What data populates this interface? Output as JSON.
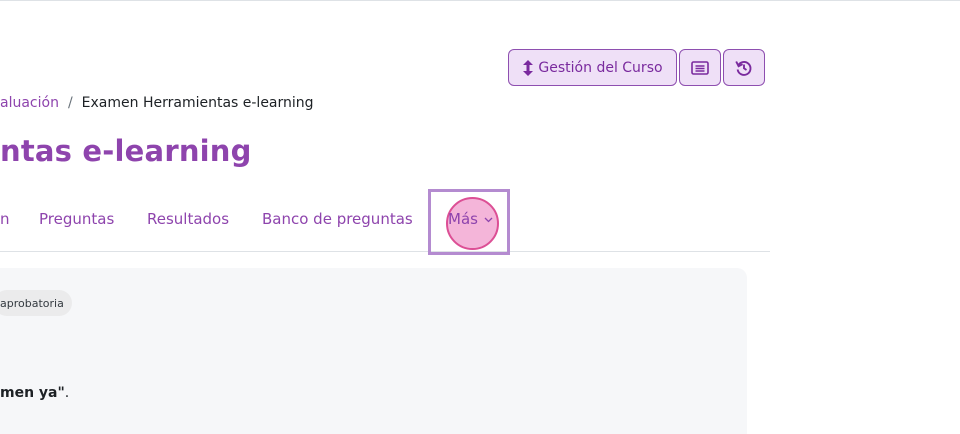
{
  "course_actions": {
    "manage_label": "Gestión del Curso",
    "icons": [
      "arrows-vertical-icon",
      "list-icon",
      "history-icon"
    ]
  },
  "breadcrumb": {
    "parent": "aluación",
    "separator": "/",
    "current": "Examen Herramientas e-learning"
  },
  "page_title": "ntas e-learning",
  "nav": {
    "items": [
      "n",
      "Preguntas",
      "Resultados",
      "Banco de preguntas"
    ],
    "more_label": "Más"
  },
  "content": {
    "badge": "aprobatoria",
    "text_bold": "men ya\"",
    "text_after": "."
  },
  "colors": {
    "brand": "#8e44ad",
    "button_bg": "#efe0f7",
    "button_border": "#8e4fb0",
    "click_indicator": "#dc4f95"
  }
}
